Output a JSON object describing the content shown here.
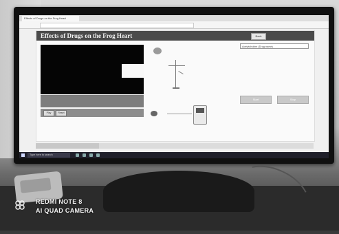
{
  "screen": {
    "browser_tab_title": "Effects of Drugs on the Frog Heart",
    "address_text": ""
  },
  "app": {
    "title": "Effects of Drugs on the Frog Heart",
    "back_label": "Back",
    "description": "",
    "buttons": [
      "Play",
      "Reset"
    ],
    "drug_select": "Acetylcholine (Drug name)",
    "info_lines": [
      "",
      "",
      "",
      ""
    ],
    "actions": [
      "Start",
      "Stop"
    ]
  },
  "taskbar": {
    "search_placeholder": "Type here to search",
    "time": "",
    "date": ""
  },
  "photo": {
    "watermark_line1": "REDMI NOTE 8",
    "watermark_line2": "AI QUAD CAMERA",
    "handwritten_note": "",
    "monitor_brand": ""
  },
  "colors": {
    "title_bar": "#4a4a4a",
    "video_panel": "#050505",
    "taskbar": "#1f1f2a"
  }
}
